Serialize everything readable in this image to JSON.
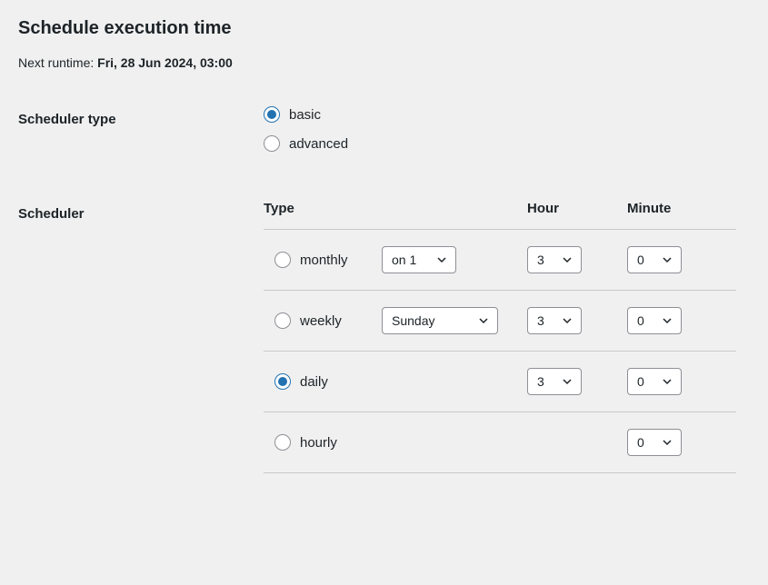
{
  "title": "Schedule execution time",
  "next_runtime": {
    "label": "Next runtime: ",
    "value": "Fri, 28 Jun 2024, 03:00"
  },
  "scheduler_type": {
    "label": "Scheduler type",
    "options": {
      "basic": "basic",
      "advanced": "advanced"
    },
    "selected": "basic"
  },
  "scheduler": {
    "label": "Scheduler",
    "headers": {
      "type": "Type",
      "hour": "Hour",
      "minute": "Minute"
    },
    "rows": {
      "monthly": {
        "label": "monthly",
        "day_select": "on 1",
        "hour": "3",
        "minute": "0",
        "selected": false
      },
      "weekly": {
        "label": "weekly",
        "weekday_select": "Sunday",
        "hour": "3",
        "minute": "0",
        "selected": false
      },
      "daily": {
        "label": "daily",
        "hour": "3",
        "minute": "0",
        "selected": true
      },
      "hourly": {
        "label": "hourly",
        "minute": "0",
        "selected": false
      }
    }
  }
}
